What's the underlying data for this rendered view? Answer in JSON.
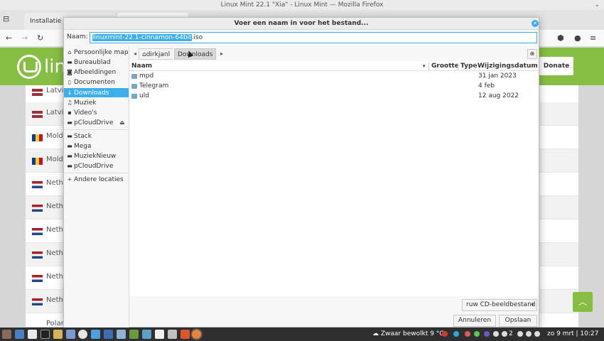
{
  "window": {
    "title": "Linux Mint 22.1 \"Xia\" - Linux Mint — Mozilla Firefox",
    "chevron": "⌄"
  },
  "tabs": [
    {
      "label": "Installatie"
    },
    {
      "label": ""
    }
  ],
  "website": {
    "logo_text": "lin",
    "donate_label": "Donate",
    "mirrors": [
      {
        "name": "Latvi",
        "flag": "lv"
      },
      {
        "name": "Latvi",
        "flag": "lv"
      },
      {
        "name": "Mold",
        "flag": "md"
      },
      {
        "name": "Mold",
        "flag": "md"
      },
      {
        "name": "Neth",
        "flag": "nl"
      },
      {
        "name": "Neth",
        "flag": "nl"
      },
      {
        "name": "Neth",
        "flag": "nl"
      },
      {
        "name": "Neth",
        "flag": "nl"
      },
      {
        "name": "Neth",
        "flag": "nl"
      },
      {
        "name": "Neth",
        "flag": "nl"
      },
      {
        "name": "Polar",
        "flag": ""
      }
    ]
  },
  "dialog": {
    "title": "Voer een naam in voor het bestand...",
    "name_label": "Naam:",
    "filename_selected": "linuxmint-22.1-cinnamon-64bit",
    "filename_ext": ".iso",
    "sidebar": [
      {
        "label": "Persoonlijke map",
        "icon": "home-icon",
        "glyph": "⌂"
      },
      {
        "label": "Bureaublad",
        "icon": "desktop-icon",
        "glyph": "▬"
      },
      {
        "label": "Afbeeldingen",
        "icon": "camera-icon",
        "glyph": "◙"
      },
      {
        "label": "Documenten",
        "icon": "document-icon",
        "glyph": "▯"
      },
      {
        "label": "Downloads",
        "icon": "download-icon",
        "glyph": "↓"
      },
      {
        "label": "Muziek",
        "icon": "music-icon",
        "glyph": "♫"
      },
      {
        "label": "Video's",
        "icon": "video-icon",
        "glyph": "▪"
      },
      {
        "label": "pCloudDrive",
        "icon": "drive-icon",
        "glyph": "▬"
      },
      {
        "label": "Stack",
        "icon": "folder-icon",
        "glyph": "▬"
      },
      {
        "label": "Mega",
        "icon": "folder-icon",
        "glyph": "▬"
      },
      {
        "label": "MuziekNieuw",
        "icon": "folder-icon",
        "glyph": "▬"
      },
      {
        "label": "pCloudDrive",
        "icon": "folder-icon",
        "glyph": "▬"
      },
      {
        "label": "Andere locaties",
        "icon": "plus-icon",
        "glyph": "+"
      }
    ],
    "path": {
      "home": "dirkjanl",
      "current": "Downloads"
    },
    "columns": {
      "name": "Naam",
      "size": "Grootte",
      "type": "Type",
      "modified": "Wijzigingsdatum"
    },
    "files": [
      {
        "name": "mpd",
        "modified": "31 jan 2023"
      },
      {
        "name": "Telegram",
        "modified": "4 feb"
      },
      {
        "name": "uld",
        "modified": "12 aug 2022"
      }
    ],
    "filter_label": "ruw CD-beeldbestand",
    "cancel_label": "Annuleren",
    "save_label": "Opslaan"
  },
  "taskbar": {
    "weather": "Zwaar bewolkt 9 °C",
    "clock": "zo 9 mrt | 10:27",
    "workspace_num": "2"
  },
  "colors": {
    "accent": "#3daee9",
    "mint_green": "#86be43",
    "taskbar": "#2f2f2f"
  }
}
